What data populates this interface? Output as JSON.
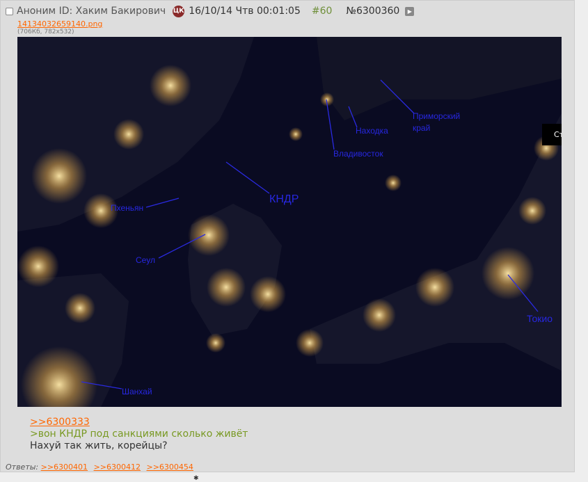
{
  "post": {
    "author": "Аноним",
    "id_label": "ID: Хаким Бакирович",
    "badge": "ЦК",
    "date": "16/10/14 Чтв 00:01:05",
    "number": "#60",
    "post_id": "№6300360",
    "expand_icon": "play-triangle-icon"
  },
  "file": {
    "name": "14134032659140.png",
    "info": "(706Кб, 782x532)"
  },
  "map_labels": {
    "pyongyang": "Пхеньян",
    "dprk": "КНДР",
    "seoul": "Сеул",
    "vladivostok": "Владивосток",
    "nakhodka": "Находка",
    "primorsky_1": "Приморский",
    "primorsky_2": "край",
    "tokyo": "Токио",
    "shanghai": "Шанхай"
  },
  "side_button": "Ст",
  "message": {
    "reply_link": ">>6300333",
    "quote": ">вон КНДР под санкциями сколько живёт",
    "text": "Нахуй так жить, корейцы?"
  },
  "replies": {
    "label": "Ответы:",
    "links": [
      ">>6300401",
      ">>6300412",
      ">>6300454"
    ]
  },
  "below_fragment": "✱",
  "colors": {
    "link": "#ff6600",
    "quote": "#789922",
    "number": "#6f8f3a",
    "label_blue": "#2222dd"
  }
}
